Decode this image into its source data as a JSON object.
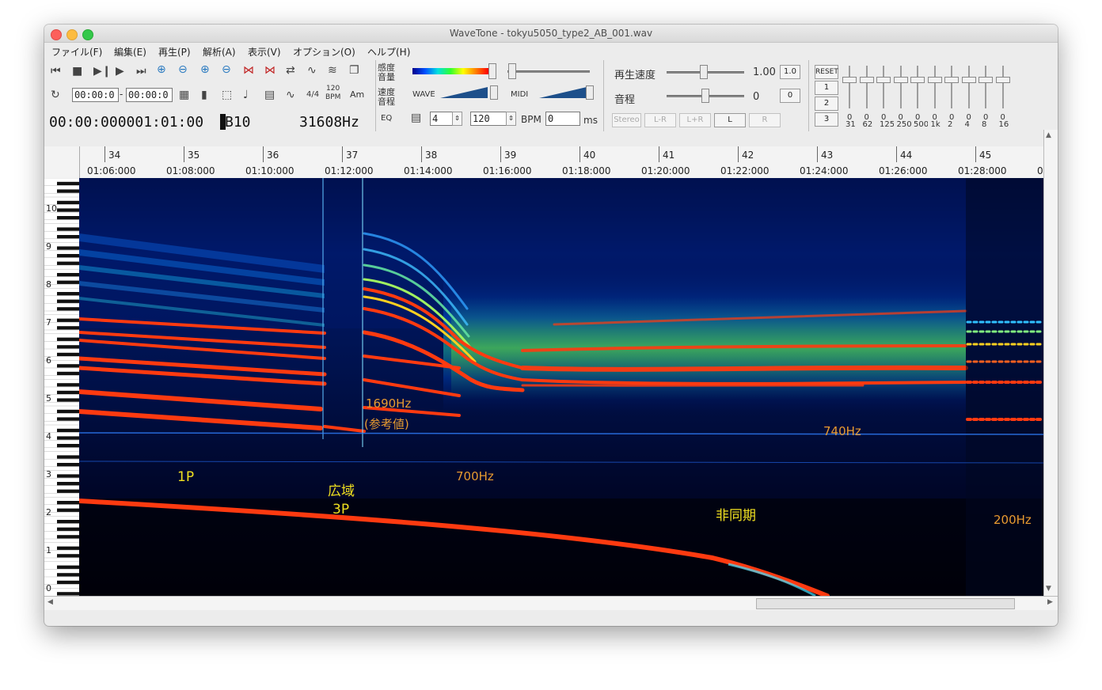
{
  "window": {
    "title": "WaveTone - tokyu5050_type2_AB_001.wav"
  },
  "menu": [
    "ファイル(F)",
    "編集(E)",
    "再生(P)",
    "解析(A)",
    "表示(V)",
    "オプション(O)",
    "ヘルプ(H)"
  ],
  "toolbar": {
    "range_start": "00:00:0",
    "range_sep": "-",
    "range_end": "00:00:0",
    "label_44": "4/4",
    "label_120bpm_top": "120",
    "label_120bpm_bottom": "BPM",
    "label_am": "Am",
    "label_eq": "EQ",
    "sens_label_1": "感度",
    "sens_label_2": "音量",
    "speed_label_1": "速度",
    "speed_label_2": "音程",
    "wave_label": "WAVE",
    "midi_label": "MIDI",
    "beats_value": "4",
    "tempo_value": "120",
    "bpm_label": "BPM",
    "ms_value": "0",
    "ms_label": "ms"
  },
  "status": {
    "time": "00:00:000001:01:00",
    "note": "B10",
    "freq": "31608Hz"
  },
  "playback": {
    "speed_label": "再生速度",
    "speed_value": "1.00",
    "speed_reset": "1.0",
    "pitch_label": "音程",
    "pitch_value": "0",
    "pitch_reset": "0",
    "stereo": "Stereo",
    "lr_minus": "L-R",
    "lr_plus": "L+R",
    "l": "L",
    "r": "R"
  },
  "eq": {
    "reset": "RESET",
    "presets": [
      "1",
      "2",
      "3"
    ],
    "band_values": [
      "0",
      "0",
      "0",
      "0",
      "0",
      "0",
      "0",
      "0",
      "0",
      "0"
    ],
    "bands": [
      "31",
      "62",
      "125",
      "250",
      "500",
      "1k",
      "2",
      "4",
      "8",
      "16"
    ]
  },
  "ruler": {
    "measures": [
      "34",
      "35",
      "36",
      "37",
      "38",
      "39",
      "40",
      "41",
      "42",
      "43",
      "44",
      "45"
    ],
    "times": [
      "01:06:000",
      "01:08:000",
      "01:10:000",
      "01:12:000",
      "01:14:000",
      "01:16:000",
      "01:18:000",
      "01:20:000",
      "01:22:000",
      "01:24:000",
      "01:26:000",
      "01:28:000",
      "0"
    ]
  },
  "piano_labels": [
    "10",
    "9",
    "8",
    "7",
    "6",
    "5",
    "4",
    "3",
    "2",
    "1",
    "0"
  ],
  "annotations": {
    "p1": "1P",
    "wide": "広域",
    "p3": "3P",
    "hz1690": "1690Hz",
    "ref": "(参考値)",
    "hz700": "700Hz",
    "hz740": "740Hz",
    "async": "非同期",
    "hz200": "200Hz"
  },
  "colors": {
    "yellow_label": "#f0e020",
    "orange_label": "#e89a30",
    "trace_red": "#ff3a10"
  }
}
